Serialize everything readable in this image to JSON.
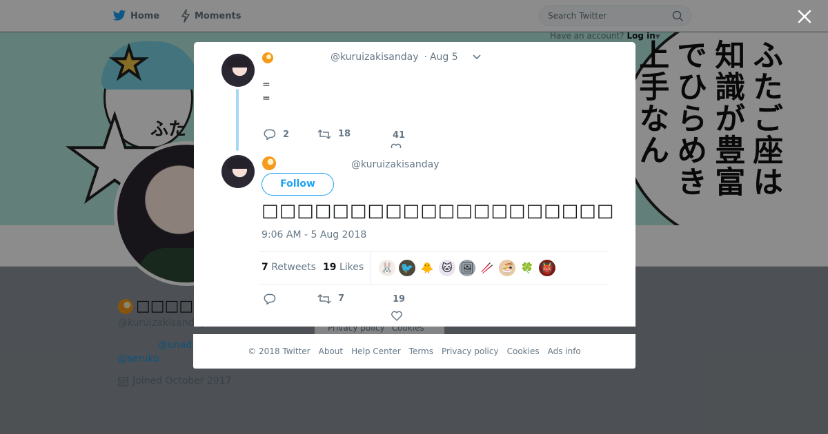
{
  "nav": {
    "home_label": "Home",
    "moments_label": "Moments",
    "search_placeholder": "Search Twitter",
    "login_prompt": "Have an account?",
    "login_label": "Log in"
  },
  "banner": {
    "text_columns": [
      "ふたご座は",
      "知識が豊富",
      "でひらめき",
      "上手なん"
    ],
    "fragment": "ふた"
  },
  "profile": {
    "name_glyphs": "□□□□□□□",
    "handle": "@kuruizakisanday",
    "link1": "@unada",
    "link2": "@seruko",
    "joined": "Joined October 2017"
  },
  "background_footer": {
    "privacy": "Privacy policy",
    "cookies": "Cookies"
  },
  "tweet_parent": {
    "handle": "@kuruizakisanday",
    "date": "Aug 5",
    "lines": [
      "=",
      "="
    ],
    "reply_count": "2",
    "retweet_count": "18",
    "like_count": "41"
  },
  "tweet_main": {
    "handle": "@kuruizakisanday",
    "follow_label": "Follow",
    "text": "□□□□□□□□□□□□□□□□□□□□□□□□□□□□□□□□□□□□□□",
    "timestamp": "9:06 AM - 5 Aug 2018",
    "retweets_count": "7",
    "retweets_label": "Retweets",
    "likes_count": "19",
    "likes_label": "Likes",
    "likers": [
      "🐰",
      "🐦",
      "🐥",
      "🐱",
      "🖼",
      "🥢",
      "🍜",
      "🍀",
      "👹"
    ],
    "reply_count": "",
    "retweet_count": "7",
    "like_count": "19"
  },
  "footer": {
    "copyright": "© 2018 Twitter",
    "about": "About",
    "help": "Help Center",
    "terms": "Terms",
    "privacy": "Privacy policy",
    "cookies": "Cookies",
    "ads": "Ads info"
  },
  "colors": {
    "brand": "#1da1f2",
    "banner_bg": "#b2e8dc",
    "thread_line": "#a7d8f5"
  },
  "icons": [
    "twitter-bird-icon",
    "lightning-icon",
    "search-icon",
    "close-icon",
    "chevron-down-icon",
    "reply-icon",
    "retweet-icon",
    "heart-icon",
    "calendar-icon"
  ]
}
